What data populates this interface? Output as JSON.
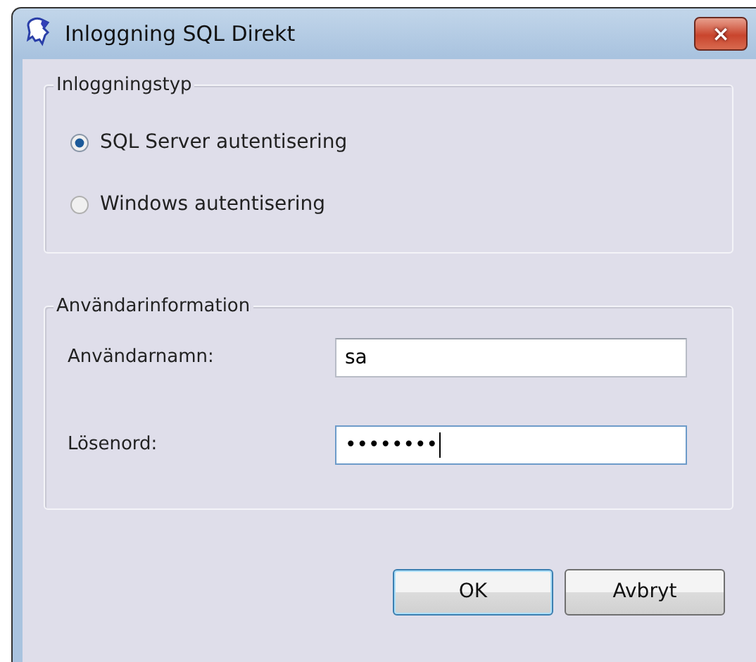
{
  "window": {
    "title": "Inloggning SQL Direkt",
    "close_label": "×"
  },
  "login_type": {
    "legend": "Inloggningstyp",
    "options": [
      {
        "label": "SQL Server autentisering",
        "selected": true
      },
      {
        "label": "Windows autentisering",
        "selected": false
      }
    ]
  },
  "user_info": {
    "legend": "Användarinformation",
    "fields": [
      {
        "label": "Användarnamn:",
        "value": "sa",
        "focused": false
      },
      {
        "label": "Lösenord:",
        "value": "••••••••",
        "focused": true
      }
    ]
  },
  "buttons": [
    {
      "label": "OK",
      "default": true
    },
    {
      "label": "Avbryt",
      "default": false
    }
  ]
}
